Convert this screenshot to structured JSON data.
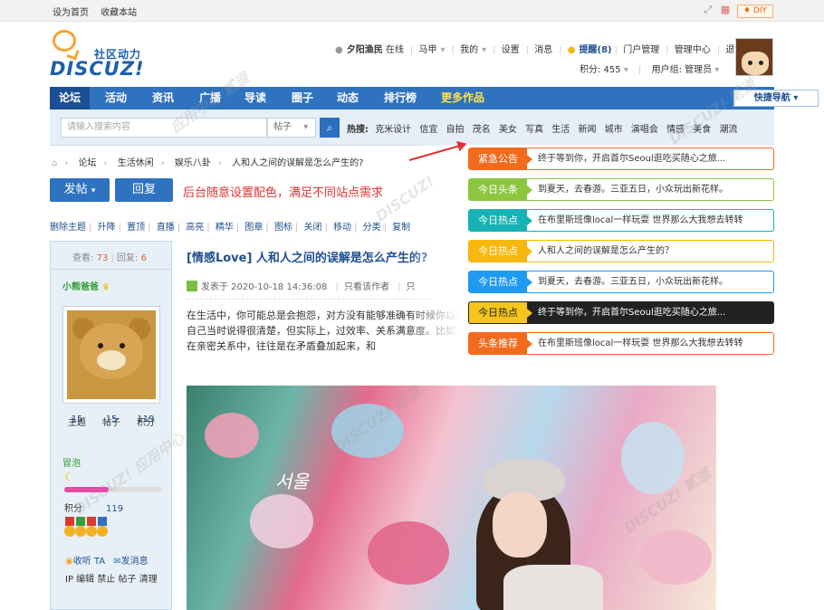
{
  "topbar": {
    "set_home": "设为首页",
    "bookmark": "收藏本站",
    "diy": "DIY"
  },
  "logo": {
    "cn": "社区动力",
    "en": "DISCUZ!"
  },
  "user": {
    "name": "夕阳渔民",
    "online": "在线",
    "horse": "马甲",
    "mine": "我的",
    "settings": "设置",
    "messages": "消息",
    "remind": "提醒(8)",
    "portal_admin": "门户管理",
    "admin_center": "管理中心",
    "logout": "退出",
    "points": "积分: 455",
    "usergroup": "用户组: 管理员"
  },
  "nav": {
    "items": [
      "论坛",
      "活动",
      "资讯",
      "广播",
      "导读",
      "圈子",
      "动态",
      "排行榜",
      "更多作品"
    ],
    "quick": "快捷导航"
  },
  "search": {
    "placeholder": "请输入搜索内容",
    "scope": "帖子",
    "hot_label": "热搜:",
    "hot": [
      "克米设计",
      "信宜",
      "自拍",
      "茂名",
      "美女",
      "写真",
      "生活",
      "新闻",
      "城市",
      "演唱会",
      "情感",
      "美食",
      "潮流"
    ]
  },
  "breadcrumb": [
    "论坛",
    "生活休闲",
    "娱乐八卦",
    "人和人之间的误解是怎么产生的?"
  ],
  "buttons": {
    "post": "发帖",
    "reply": "回复"
  },
  "annotation": "后台随意设置配色，满足不同站点需求",
  "modbar": [
    "删除主题",
    "升降",
    "置顶",
    "直播",
    "高亮",
    "精华",
    "图章",
    "图标",
    "关闭",
    "移动",
    "分类",
    "复制"
  ],
  "sidebar": {
    "views_label": "查看:",
    "views": "73",
    "replies_label": "回复:",
    "replies": "6",
    "username": "小熊爸爸",
    "stats": [
      {
        "value": "15",
        "label": "主题"
      },
      {
        "value": "15",
        "label": "帖子"
      },
      {
        "value": "119",
        "label": "积分"
      }
    ],
    "bubble": "冒泡",
    "level_progress": 0.45,
    "points_label": "积分",
    "points": "119",
    "listen": "收听 TA",
    "send_msg": "发消息",
    "admin_links": "IP 编辑 禁止 帖子 清理"
  },
  "post": {
    "title": "[情感Love] 人和人之间的误解是怎么产生的?",
    "published": "发表于 2020-10-18 14:36:08",
    "only_author": "只看该作者",
    "only": "只",
    "body": "在生活中，你可能总是会抱怨，对方没有能够准确有时候你以为自己当时说得很清楚，但实际上，过效率、关系满意度。比如，在亲密关系中，往往是在矛盾叠加起来，和",
    "photo_text": "서울"
  },
  "announcements": [
    {
      "tag": "紧急公告",
      "text": "终于等到你，开启首尔Seoul逛吃买随心之旅...",
      "color": "#f26b1d",
      "border": "#f26b1d"
    },
    {
      "tag": "今日头条",
      "text": "到夏天，去春游。三亚五日，小众玩出新花样。",
      "color": "#8cc63e",
      "border": "#8cc63e"
    },
    {
      "tag": "今日热点",
      "text": "在布里斯班像local一样玩耍 世界那么大我想去转转",
      "color": "#17b2b5",
      "border": "#17b2b5"
    },
    {
      "tag": "今日热点",
      "text": "人和人之间的误解是怎么产生的？",
      "color": "#f6b70e",
      "border": "#f6b70e"
    },
    {
      "tag": "今日热点",
      "text": "到夏天，去春游。三亚五日，小众玩出新花样。",
      "color": "#1e9af0",
      "border": "#1e9af0"
    },
    {
      "tag": "今日热点",
      "text": "终于等到你，开启首尔Seoul逛吃买随心之旅...",
      "color": "#f6c51b",
      "border": "#222222",
      "dark": true
    },
    {
      "tag": "头条推荐",
      "text": "在布里斯班像local一样玩耍 世界那么大我想去转转",
      "color": "#f26b1d",
      "border": "#f26b1d"
    }
  ]
}
